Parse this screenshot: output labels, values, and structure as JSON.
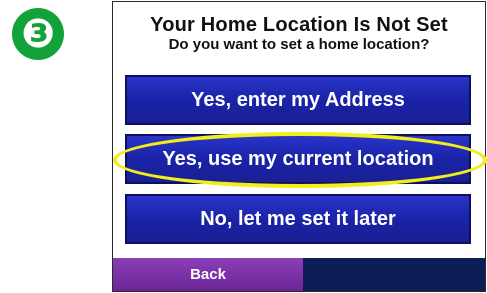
{
  "step": {
    "number_glyph": "❸",
    "color": "#12a23a"
  },
  "dialog": {
    "title": "Your Home Location Is Not Set",
    "subtitle": "Do you want to set a home location?"
  },
  "options": [
    {
      "label": "Yes, enter my Address"
    },
    {
      "label": "Yes, use my current location",
      "highlighted": true
    },
    {
      "label": "No, let me set it later"
    }
  ],
  "footer": {
    "back_label": "Back"
  },
  "colors": {
    "button_blue": "#1a23a8",
    "highlight_yellow": "#f2ee1a",
    "back_purple": "#7a2fa8",
    "bar_navy": "#0c1e57"
  }
}
